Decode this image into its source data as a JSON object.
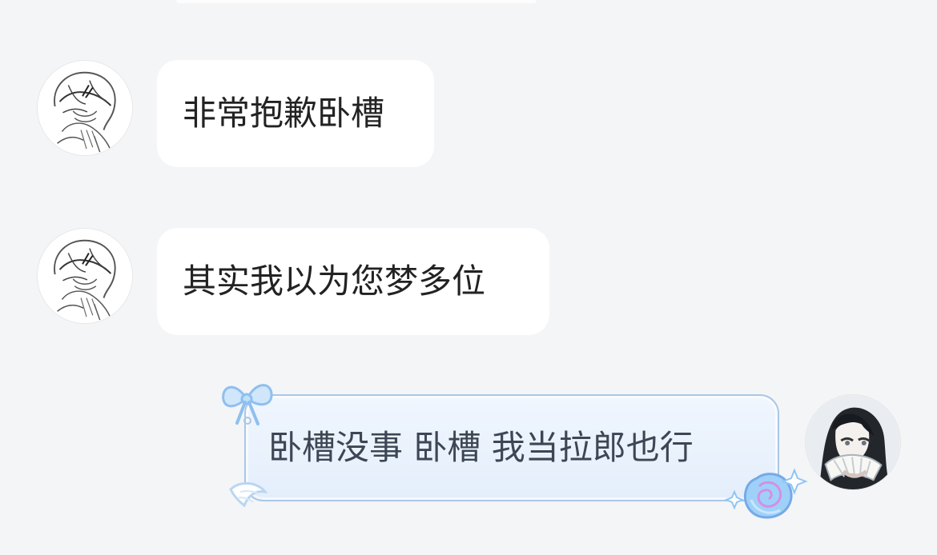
{
  "messages": [
    {
      "sender": "other",
      "text": "非常抱歉卧槽",
      "avatar_icon": "sketch-character-avatar-icon"
    },
    {
      "sender": "other",
      "text": "其实我以为您梦多位",
      "avatar_icon": "sketch-character-avatar-icon"
    },
    {
      "sender": "self",
      "text": "卧槽没事 卧槽 我当拉郎也行",
      "avatar_icon": "dark-hair-character-avatar-icon"
    }
  ],
  "theme": {
    "background": "#f4f5f7",
    "incoming_bubble": "#ffffff",
    "outgoing_bubble": "#e8f1fc",
    "outgoing_border": "#a9c7e6",
    "decoration_blue": "#8fbfee"
  }
}
